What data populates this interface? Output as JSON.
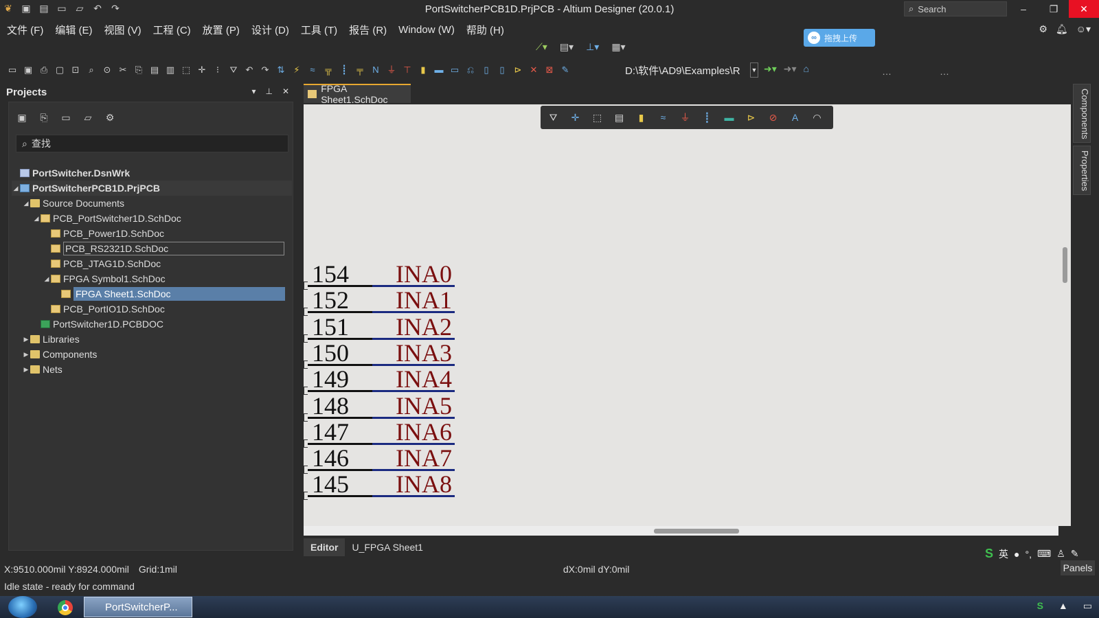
{
  "window": {
    "title": "PortSwitcherPCB1D.PrjPCB - Altium Designer (20.0.1)",
    "search_placeholder": "Search"
  },
  "menu": [
    "文件 (F)",
    "编辑 (E)",
    "视图 (V)",
    "工程 (C)",
    "放置 (P)",
    "设计 (D)",
    "工具 (T)",
    "报告 (R)",
    "Window (W)",
    "帮助 (H)"
  ],
  "upload_button": "拖拽上传",
  "toolbar": {
    "path": "D:\\软件\\AD9\\Examples\\R"
  },
  "projects": {
    "title": "Projects",
    "search_placeholder": "查找",
    "tree": [
      {
        "label": "PortSwitcher.DsnWrk",
        "level": 0,
        "icon": "workspace-icon",
        "bold": true
      },
      {
        "label": "PortSwitcherPCB1D.PrjPCB",
        "level": 0,
        "icon": "project-icon",
        "bold": true,
        "expanded": true
      },
      {
        "label": "Source Documents",
        "level": 1,
        "icon": "folder-icon",
        "expanded": true
      },
      {
        "label": "PCB_PortSwitcher1D.SchDoc",
        "level": 2,
        "icon": "schdoc-icon",
        "expanded": true
      },
      {
        "label": "PCB_Power1D.SchDoc",
        "level": 3,
        "icon": "schdoc-icon"
      },
      {
        "label": "PCB_RS2321D.SchDoc",
        "level": 3,
        "icon": "schdoc-icon",
        "outlined": true
      },
      {
        "label": "PCB_JTAG1D.SchDoc",
        "level": 3,
        "icon": "schdoc-icon"
      },
      {
        "label": "FPGA Symbol1.SchDoc",
        "level": 3,
        "icon": "schdoc-icon",
        "expanded": true
      },
      {
        "label": "FPGA Sheet1.SchDoc",
        "level": 4,
        "icon": "schdoc-icon",
        "selected": true
      },
      {
        "label": "PCB_PortIO1D.SchDoc",
        "level": 3,
        "icon": "schdoc-icon"
      },
      {
        "label": "PortSwitcher1D.PCBDOC",
        "level": 2,
        "icon": "pcbdoc-icon"
      },
      {
        "label": "Libraries",
        "level": 1,
        "icon": "folder-icon",
        "collapsed": true
      },
      {
        "label": "Components",
        "level": 1,
        "icon": "folder-icon",
        "collapsed": true
      },
      {
        "label": "Nets",
        "level": 1,
        "icon": "folder-icon",
        "collapsed": true
      }
    ]
  },
  "document_tab": "FPGA Sheet1.SchDoc",
  "schematic_pins": [
    {
      "number": "154",
      "net": "INA0"
    },
    {
      "number": "152",
      "net": "INA1"
    },
    {
      "number": "151",
      "net": "INA2"
    },
    {
      "number": "150",
      "net": "INA3"
    },
    {
      "number": "149",
      "net": "INA4"
    },
    {
      "number": "148",
      "net": "INA5"
    },
    {
      "number": "147",
      "net": "INA6"
    },
    {
      "number": "146",
      "net": "INA7"
    },
    {
      "number": "145",
      "net": "INA8"
    }
  ],
  "right_panels": [
    "Components",
    "Properties"
  ],
  "bottom_tabs": [
    "Editor",
    "U_FPGA Sheet1"
  ],
  "status": {
    "coords": "X:9510.000mil Y:8924.000mil",
    "grid": "Grid:1mil",
    "delta": "dX:0mil dY:0mil",
    "state": "Idle state - ready for command",
    "panels": "Panels",
    "ime": "英"
  },
  "taskbar": {
    "app": "PortSwitcherP..."
  }
}
